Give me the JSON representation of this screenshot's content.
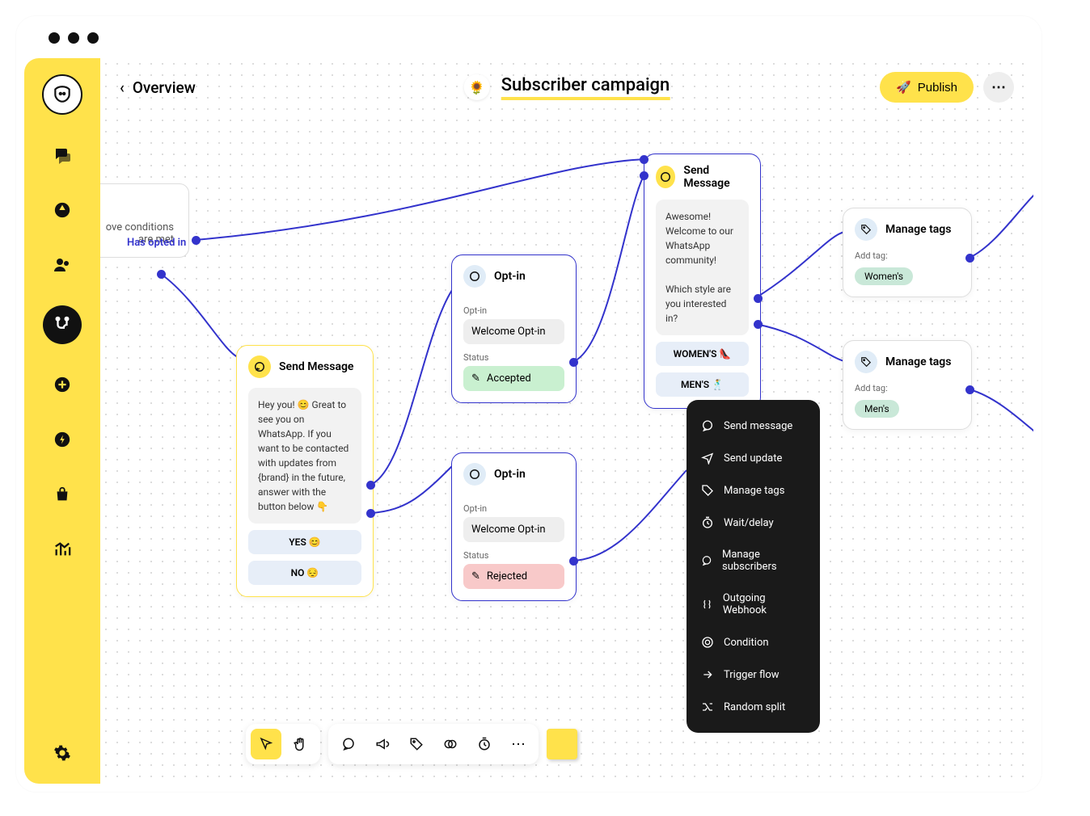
{
  "topbar": {
    "back_label": "Overview",
    "title": "Subscriber campaign",
    "publish_label": "Publish"
  },
  "peek_node": {
    "line1": "ove conditions",
    "line2": "are met",
    "link": "Has opted in"
  },
  "node_send1": {
    "title": "Send Message",
    "body": "Hey you! 😊 Great to see you on WhatsApp. If you want to be contacted with updates from {brand} in the future, answer with the button below 👇",
    "btn_yes": "YES 😊",
    "btn_no": "NO 😔"
  },
  "node_optin1": {
    "title": "Opt-in",
    "field_label": "Opt-in",
    "field_value": "Welcome Opt-in",
    "status_label": "Status",
    "status_value": "Accepted"
  },
  "node_optin2": {
    "title": "Opt-in",
    "field_label": "Opt-in",
    "field_value": "Welcome Opt-in",
    "status_label": "Status",
    "status_value": "Rejected"
  },
  "node_send2": {
    "title": "Send Message",
    "body": "Awesome! Welcome to our WhatsApp community!\n\nWhich style are you interested in?",
    "btn_womens": "WOMEN'S 👠",
    "btn_mens": "MEN'S 🕺"
  },
  "node_tags1": {
    "title": "Manage tags",
    "label": "Add tag:",
    "tag": "Women's"
  },
  "node_tags2": {
    "title": "Manage tags",
    "label": "Add tag:",
    "tag": "Men's"
  },
  "context_menu": {
    "items": [
      "Send message",
      "Send update",
      "Manage tags",
      "Wait/delay",
      "Manage subscribers",
      "Outgoing Webhook",
      "Condition",
      "Trigger flow",
      "Random split"
    ]
  }
}
